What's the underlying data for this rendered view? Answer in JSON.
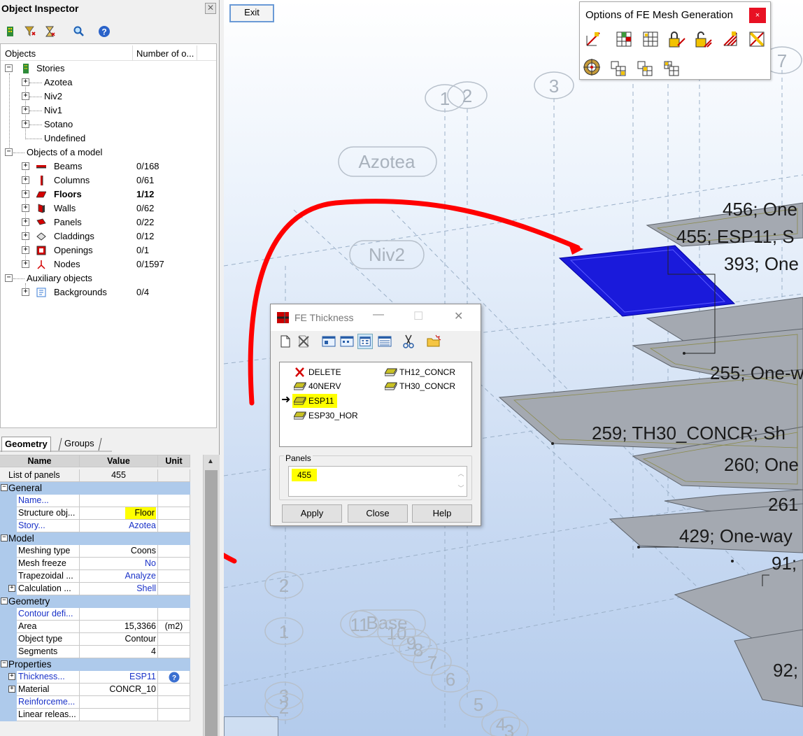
{
  "inspector": {
    "title": "Object Inspector",
    "close_glyph": "✕",
    "toolbar": [
      "select-story-icon",
      "filter-icon",
      "hourglass-icon",
      "search-icon",
      "help-icon"
    ],
    "columns": {
      "objects": "Objects",
      "count": "Number of o..."
    },
    "tree": {
      "stories": {
        "label": "Stories",
        "children": [
          "Azotea",
          "Niv2",
          "Niv1",
          "Sotano",
          "Undefined"
        ]
      },
      "model": {
        "label": "Objects of a model",
        "items": [
          {
            "label": "Beams",
            "count": "0/168"
          },
          {
            "label": "Columns",
            "count": "0/61"
          },
          {
            "label": "Floors",
            "count": "1/12"
          },
          {
            "label": "Walls",
            "count": "0/62"
          },
          {
            "label": "Panels",
            "count": "0/22"
          },
          {
            "label": "Claddings",
            "count": "0/12"
          },
          {
            "label": "Openings",
            "count": "0/1"
          },
          {
            "label": "Nodes",
            "count": "0/1597"
          }
        ]
      },
      "auxiliary": {
        "label": "Auxiliary objects",
        "items": [
          {
            "label": "Backgrounds",
            "count": "0/4"
          }
        ]
      }
    },
    "tabs": [
      "Geometry",
      "Groups"
    ],
    "grid": {
      "headers": {
        "name": "Name",
        "value": "Value",
        "unit": "Unit"
      },
      "list_of_panels": {
        "name": "List of panels",
        "value": "455"
      },
      "sections": {
        "general": "General",
        "model": "Model",
        "geometry": "Geometry",
        "properties": "Properties"
      },
      "rows": {
        "name": {
          "name": "Name...",
          "value": ""
        },
        "structure": {
          "name": "Structure obj...",
          "value": "Floor"
        },
        "story": {
          "name": "Story...",
          "value": "Azotea"
        },
        "meshing": {
          "name": "Meshing type",
          "value": "Coons"
        },
        "freeze": {
          "name": "Mesh freeze",
          "value": "No"
        },
        "trapezoidal": {
          "name": "Trapezoidal ...",
          "value": "Analyze"
        },
        "calculation": {
          "name": "Calculation ...",
          "value": "Shell"
        },
        "contour": {
          "name": "Contour defi...",
          "value": ""
        },
        "area": {
          "name": "Area",
          "value": "15,3366",
          "unit": "(m2)"
        },
        "object_type": {
          "name": "Object type",
          "value": "Contour"
        },
        "segments": {
          "name": "Segments",
          "value": "4"
        },
        "thickness": {
          "name": "Thickness...",
          "value": "ESP11"
        },
        "material": {
          "name": "Material",
          "value": "CONCR_10"
        },
        "reinforcement": {
          "name": "Reinforceme...",
          "value": ""
        },
        "linear": {
          "name": "Linear releas...",
          "value": ""
        }
      }
    }
  },
  "viewport": {
    "exit_label": "Exit",
    "bubbles": {
      "axes": [
        "1",
        "2",
        "3",
        "7"
      ],
      "stories": [
        "Azotea",
        "Niv2"
      ],
      "base": "Base",
      "left_numbers": [
        "2",
        "1",
        "3",
        "2"
      ],
      "base_numbers": [
        "11",
        "10",
        "9",
        "8",
        "7",
        "6",
        "5",
        "4",
        "3"
      ]
    },
    "panel_labels": [
      "456; One",
      "455; ESP11; S",
      "393; One",
      "255; One-w",
      "259; TH30_CONCR; Sh",
      "260; One",
      "261",
      "429; One-way",
      "91;",
      "92;"
    ],
    "colors": {
      "selected_panel": "#1a1adb",
      "panel": "#a4a9b1",
      "annotation": "#ff0000"
    }
  },
  "mesh_options": {
    "title": "Options of FE Mesh Generation",
    "close_glyph": "×",
    "icons": [
      "mesh-auto-icon",
      "mesh-table-icon",
      "mesh-grid-icon",
      "mesh-lock-icon",
      "mesh-unlock-icon",
      "mesh-refine-icon",
      "mesh-delete-icon",
      "mesh-target-icon",
      "mesh-split-icon",
      "mesh-merge-icon",
      "mesh-join-icon"
    ]
  },
  "thickness_dialog": {
    "title": "FE Thickness",
    "minimize_glyph": "—",
    "maximize_glyph": "☐",
    "close_glyph": "✕",
    "items": [
      {
        "label": "DELETE",
        "icon": "delete-x-icon"
      },
      {
        "label": "40NERV",
        "icon": "slab-icon"
      },
      {
        "label": "ESP11",
        "icon": "slab-icon",
        "selected": true
      },
      {
        "label": "ESP30_HOR",
        "icon": "slab-icon"
      },
      {
        "label": "TH12_CONCR",
        "icon": "slab-icon"
      },
      {
        "label": "TH30_CONCR",
        "icon": "slab-icon"
      }
    ],
    "panels_label": "Panels",
    "panels_value": "455",
    "buttons": {
      "apply": "Apply",
      "close": "Close",
      "help": "Help"
    }
  }
}
